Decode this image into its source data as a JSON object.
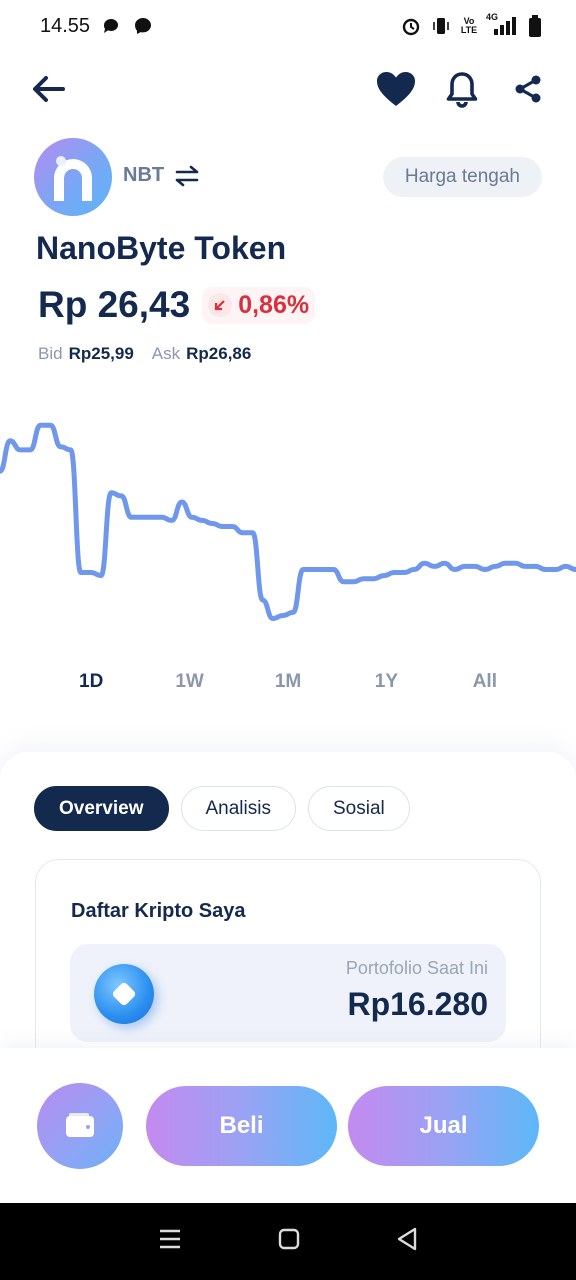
{
  "status_bar": {
    "time": "14.55",
    "left_icons": [
      "chat-icon",
      "messenger-icon"
    ],
    "right_icons": [
      "alarm-icon",
      "vibrate-icon",
      "volte-icon",
      "signal-4g-icon",
      "battery-icon"
    ],
    "volte_text": "Vo LTE",
    "network_text": "4G"
  },
  "nav": {
    "back_icon": "arrow-left-icon",
    "favorite_icon": "heart-icon",
    "alert_icon": "bell-icon",
    "share_icon": "share-icon"
  },
  "token": {
    "symbol": "NBT",
    "swap_icon": "swap-arrows-icon",
    "name": "NanoByte Token",
    "price": "Rp 26,43",
    "change": "0,86%",
    "change_direction": "down",
    "bid_label": "Bid",
    "bid_value": "Rp25,99",
    "ask_label": "Ask",
    "ask_value": "Rp26,86",
    "mid_price_label": "Harga tengah"
  },
  "colors": {
    "primary": "#14294e",
    "line": "#6f98ec",
    "negative": "#d8313d",
    "gradient_start": "#c38af0",
    "gradient_end": "#5db8f8"
  },
  "chart_data": {
    "type": "line",
    "title": "",
    "xlabel": "",
    "ylabel": "",
    "grid": false,
    "legend": "none",
    "x": [
      0,
      1,
      2,
      3,
      4,
      5,
      6,
      7,
      8,
      9,
      10,
      11,
      12,
      13,
      14,
      15,
      16,
      17,
      18,
      19,
      20,
      21,
      22,
      23,
      24,
      25,
      26,
      27,
      28,
      29,
      30,
      31,
      32,
      33,
      34,
      35,
      36,
      37,
      38,
      39,
      40,
      41,
      42,
      43,
      44,
      45,
      46,
      47,
      48,
      49,
      50,
      51,
      52,
      53,
      54,
      55,
      56,
      57
    ],
    "y": [
      26.95,
      27.05,
      27.02,
      27.02,
      27.1,
      27.1,
      27.03,
      27.02,
      26.62,
      26.62,
      26.61,
      26.88,
      26.87,
      26.8,
      26.8,
      26.8,
      26.8,
      26.79,
      26.85,
      26.8,
      26.79,
      26.78,
      26.77,
      26.77,
      26.75,
      26.75,
      26.53,
      26.47,
      26.48,
      26.49,
      26.63,
      26.63,
      26.63,
      26.63,
      26.59,
      26.59,
      26.6,
      26.6,
      26.61,
      26.62,
      26.62,
      26.63,
      26.65,
      26.64,
      26.65,
      26.63,
      26.64,
      26.64,
      26.63,
      26.64,
      26.65,
      26.65,
      26.64,
      26.64,
      26.63,
      26.63,
      26.64,
      26.63
    ],
    "ylim": [
      26.4,
      27.15
    ]
  },
  "range_tabs": [
    {
      "label": "1D",
      "active": true
    },
    {
      "label": "1W",
      "active": false
    },
    {
      "label": "1M",
      "active": false
    },
    {
      "label": "1Y",
      "active": false
    },
    {
      "label": "All",
      "active": false
    }
  ],
  "content_tabs": [
    {
      "label": "Overview",
      "active": true
    },
    {
      "label": "Analisis",
      "active": false
    },
    {
      "label": "Sosial",
      "active": false
    }
  ],
  "portfolio": {
    "title": "Daftar Kripto Saya",
    "label": "Portofolio Saat Ini",
    "value": "Rp16.280",
    "coin_icon": "coin-icon"
  },
  "actions": {
    "wallet_icon": "wallet-icon",
    "buy": "Beli",
    "sell": "Jual"
  },
  "system_nav": {
    "menu_icon": "menu-icon",
    "home_icon": "home-square-icon",
    "back_icon": "back-triangle-icon"
  }
}
